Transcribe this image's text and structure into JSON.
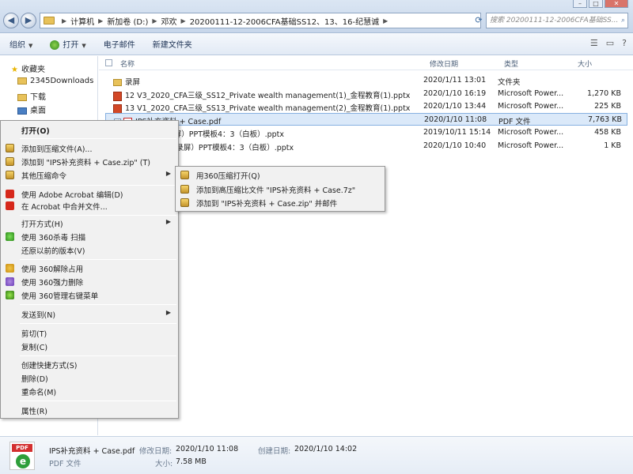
{
  "addressbar": {
    "crumbs": [
      "计算机",
      "新加卷 (D:)",
      "邓欢",
      "20200111-12-2006CFA基础SS12、13、16-纪慧诚"
    ],
    "search_placeholder": "搜索 20200111-12-2006CFA基础SS..."
  },
  "toolbar": {
    "organize": "组织",
    "open": "打开",
    "email": "电子邮件",
    "new_folder": "新建文件夹"
  },
  "nav": {
    "favorites": "收藏夹",
    "items": [
      "2345Downloads",
      "下载",
      "桌面"
    ]
  },
  "columns": {
    "name": "名称",
    "date": "修改日期",
    "type": "类型",
    "size": "大小"
  },
  "files": [
    {
      "name": "录屏",
      "date": "2020/1/11 13:01",
      "type": "文件夹",
      "size": "",
      "icon": "folder"
    },
    {
      "name": "12 V3_2020_CFA三级_SS12_Private wealth management(1)_金程教育(1).pptx",
      "date": "2020/1/10 16:19",
      "type": "Microsoft Power...",
      "size": "1,270 KB",
      "icon": "ppt"
    },
    {
      "name": "13 V1_2020_CFA三级_SS13_Private wealth management(2)_金程教育(1).pptx",
      "date": "2020/1/10 13:44",
      "type": "Microsoft Power...",
      "size": "225 KB",
      "icon": "ppt"
    },
    {
      "name": "IPS补充资料 + Case.pdf",
      "date": "2020/1/10 11:08",
      "type": "PDF 文件",
      "size": "7,763 KB",
      "icon": "pdf",
      "selected": true
    },
    {
      "name": "_传统网课（录屏）PPT模板4：3（白板）.pptx",
      "date": "2019/10/11 15:14",
      "type": "Microsoft Power...",
      "size": "458 KB",
      "icon": "ppt"
    },
    {
      "name": "29_传统网课（录屏）PPT模板4：3（白板）.pptx",
      "date": "2020/1/10 10:40",
      "type": "Microsoft Power...",
      "size": "1 KB",
      "icon": "ppt"
    }
  ],
  "context_menu": {
    "open": "打开(O)",
    "add_to_archive": "添加到压缩文件(A)...",
    "add_to_zip": "添加到 \"IPS补充资料 + Case.zip\" (T)",
    "other_compress": "其他压缩命令",
    "acrobat_edit": "使用 Adobe Acrobat 编辑(D)",
    "acrobat_combine": "在 Acrobat 中合并文件...",
    "open_with": "打开方式(H)",
    "scan_360": "使用 360杀毒 扫描",
    "restore": "还原以前的版本(V)",
    "unlock_360": "使用 360解除占用",
    "force_delete_360": "使用 360强力删除",
    "manage_menu_360": "使用 360管理右键菜单",
    "send_to": "发送到(N)",
    "cut": "剪切(T)",
    "copy": "复制(C)",
    "create_shortcut": "创建快捷方式(S)",
    "delete": "删除(D)",
    "rename": "重命名(M)",
    "properties": "属性(R)"
  },
  "submenu": {
    "open_360zip": "用360压缩打开(Q)",
    "add_7z": "添加到高压缩比文件 \"IPS补充资料 + Case.7z\"",
    "add_zip_email": "添加到 \"IPS补充资料 + Case.zip\" 并邮件"
  },
  "details": {
    "filename": "IPS补充资料 + Case.pdf",
    "modified_label": "修改日期:",
    "modified": "2020/1/10 11:08",
    "created_label": "创建日期:",
    "created": "2020/1/10 14:02",
    "type": "PDF 文件",
    "size_label": "大小:",
    "size": "7.58 MB",
    "pdf_tag": "PDF"
  }
}
